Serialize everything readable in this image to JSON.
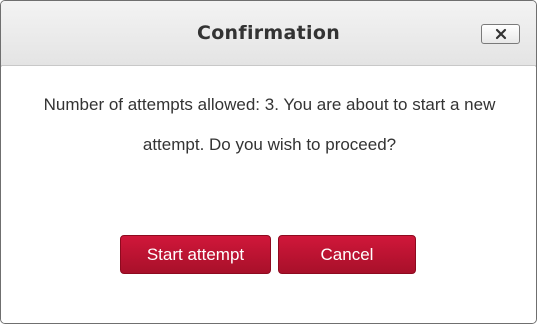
{
  "dialog": {
    "title": "Confirmation",
    "close_icon": "close-icon",
    "message": "Number of attempts allowed: 3. You are about to start a new attempt. Do you wish to proceed?",
    "buttons": {
      "start_label": "Start attempt",
      "cancel_label": "Cancel"
    }
  },
  "colors": {
    "button_primary": "#b8132f",
    "header_bg": "#ececec",
    "text": "#333333"
  }
}
